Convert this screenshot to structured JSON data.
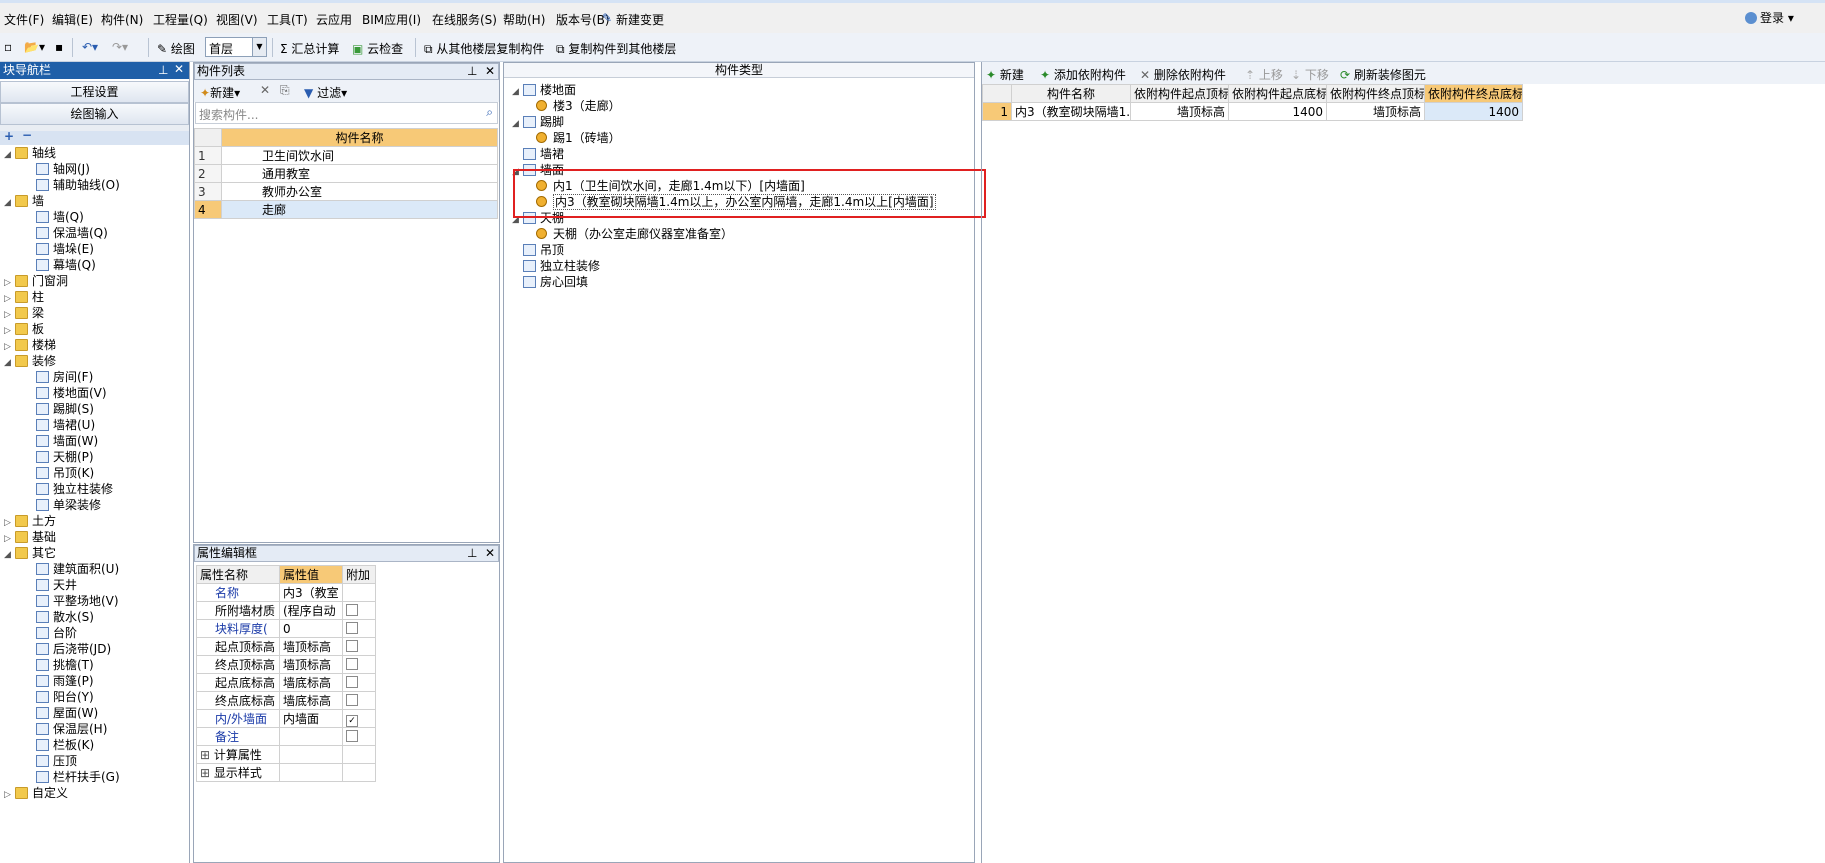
{
  "menu": [
    "文件(F)",
    "编辑(E)",
    "构件(N)",
    "工程量(Q)",
    "视图(V)",
    "工具(T)",
    "云应用",
    "BIM应用(I)",
    "在线服务(S)",
    "帮助(H)",
    "版本号(B)",
    "新建变更"
  ],
  "login": "登录",
  "toolbar": {
    "draw": "绘图",
    "floor": "首层",
    "sum": "汇总计算",
    "cloud_check": "云检查",
    "copy_from": "从其他楼层复制构件",
    "copy_to": "复制构件到其他楼层"
  },
  "nav": {
    "title": "块导航栏",
    "btn_project": "工程设置",
    "btn_draw": "绘图输入",
    "tree": [
      {
        "label": "轴线",
        "level": 0,
        "exp": "◢",
        "folder": true
      },
      {
        "label": "轴网(J)",
        "level": 1
      },
      {
        "label": "辅助轴线(O)",
        "level": 1
      },
      {
        "label": "墙",
        "level": 0,
        "exp": "◢",
        "folder": true
      },
      {
        "label": "墙(Q)",
        "level": 1
      },
      {
        "label": "保温墙(Q)",
        "level": 1
      },
      {
        "label": "墙垛(E)",
        "level": 1
      },
      {
        "label": "幕墙(Q)",
        "level": 1
      },
      {
        "label": "门窗洞",
        "level": 0,
        "exp": "▷",
        "folder": true
      },
      {
        "label": "柱",
        "level": 0,
        "exp": "▷",
        "folder": true
      },
      {
        "label": "梁",
        "level": 0,
        "exp": "▷",
        "folder": true
      },
      {
        "label": "板",
        "level": 0,
        "exp": "▷",
        "folder": true
      },
      {
        "label": "楼梯",
        "level": 0,
        "exp": "▷",
        "folder": true
      },
      {
        "label": "装修",
        "level": 0,
        "exp": "◢",
        "folder": true
      },
      {
        "label": "房间(F)",
        "level": 1
      },
      {
        "label": "楼地面(V)",
        "level": 1
      },
      {
        "label": "踢脚(S)",
        "level": 1
      },
      {
        "label": "墙裙(U)",
        "level": 1
      },
      {
        "label": "墙面(W)",
        "level": 1
      },
      {
        "label": "天棚(P)",
        "level": 1
      },
      {
        "label": "吊顶(K)",
        "level": 1
      },
      {
        "label": "独立柱装修",
        "level": 1
      },
      {
        "label": "单梁装修",
        "level": 1
      },
      {
        "label": "土方",
        "level": 0,
        "exp": "▷",
        "folder": true
      },
      {
        "label": "基础",
        "level": 0,
        "exp": "▷",
        "folder": true
      },
      {
        "label": "其它",
        "level": 0,
        "exp": "◢",
        "folder": true
      },
      {
        "label": "建筑面积(U)",
        "level": 1
      },
      {
        "label": "天井",
        "level": 1
      },
      {
        "label": "平整场地(V)",
        "level": 1
      },
      {
        "label": "散水(S)",
        "level": 1
      },
      {
        "label": "台阶",
        "level": 1
      },
      {
        "label": "后浇带(JD)",
        "level": 1
      },
      {
        "label": "挑檐(T)",
        "level": 1
      },
      {
        "label": "雨篷(P)",
        "level": 1
      },
      {
        "label": "阳台(Y)",
        "level": 1
      },
      {
        "label": "屋面(W)",
        "level": 1
      },
      {
        "label": "保温层(H)",
        "level": 1
      },
      {
        "label": "栏板(K)",
        "level": 1
      },
      {
        "label": "压顶",
        "level": 1
      },
      {
        "label": "栏杆扶手(G)",
        "level": 1
      },
      {
        "label": "自定义",
        "level": 0,
        "exp": "▷",
        "folder": true
      }
    ]
  },
  "component_list": {
    "title": "构件列表",
    "new": "新建",
    "filter": "过滤",
    "search_placeholder": "搜索构件...",
    "col_name": "构件名称",
    "rows": [
      {
        "num": "1",
        "name": "卫生间饮水间"
      },
      {
        "num": "2",
        "name": "通用教室"
      },
      {
        "num": "3",
        "name": "教师办公室"
      },
      {
        "num": "4",
        "name": "走廊"
      }
    ]
  },
  "props": {
    "title": "属性编辑框",
    "col_name": "属性名称",
    "col_value": "属性值",
    "col_extra": "附加",
    "rows": [
      {
        "name": "名称",
        "value": "内3（教室",
        "blue": true,
        "check": false,
        "nocheck": true
      },
      {
        "name": "所附墙材质",
        "value": "(程序自动",
        "blue": false,
        "check": false
      },
      {
        "name": "块料厚度(",
        "value": "0",
        "blue": true,
        "check": false
      },
      {
        "name": "起点顶标高",
        "value": "墙顶标高",
        "blue": false,
        "check": false
      },
      {
        "name": "终点顶标高",
        "value": "墙顶标高",
        "blue": false,
        "check": false
      },
      {
        "name": "起点底标高",
        "value": "墙底标高",
        "blue": false,
        "check": false
      },
      {
        "name": "终点底标高",
        "value": "墙底标高",
        "blue": false,
        "check": false
      },
      {
        "name": "内/外墙面",
        "value": "内墙面",
        "blue": true,
        "check": true
      },
      {
        "name": "备注",
        "value": "",
        "blue": true,
        "check": false
      }
    ],
    "groups": [
      "计算属性",
      "显示样式"
    ]
  },
  "types": {
    "title": "构件类型",
    "items": [
      {
        "label": "楼地面",
        "level": 0,
        "exp": "◢"
      },
      {
        "label": "楼3（走廊）",
        "level": 1
      },
      {
        "label": "踢脚",
        "level": 0,
        "exp": "◢"
      },
      {
        "label": "踢1（砖墙）",
        "level": 1
      },
      {
        "label": "墙裙",
        "level": 0,
        "exp": ""
      },
      {
        "label": "墙面",
        "level": 0,
        "exp": "◢"
      },
      {
        "label": "内1（卫生间饮水间，走廊1.4m以下）[内墙面]",
        "level": 1
      },
      {
        "label": "内3（教室砌块隔墙1.4m以上，办公室内隔墙，走廊1.4m以上[内墙面]",
        "level": 1,
        "selected": true
      },
      {
        "label": "天棚",
        "level": 0,
        "exp": "◢"
      },
      {
        "label": "天棚（办公室走廊仪器室准备室）",
        "level": 1
      },
      {
        "label": "吊顶",
        "level": 0,
        "exp": ""
      },
      {
        "label": "独立柱装修",
        "level": 0,
        "exp": ""
      },
      {
        "label": "房心回填",
        "level": 0,
        "exp": ""
      }
    ]
  },
  "attach": {
    "toolbar": [
      "新建",
      "添加依附构件",
      "删除依附构件",
      "上移",
      "下移",
      "刷新装修图元"
    ],
    "headers": [
      "构件名称",
      "依附构件起点顶标",
      "依附构件起点底标",
      "依附构件终点顶标",
      "依附构件终点底标"
    ],
    "rows": [
      {
        "num": "1",
        "cells": [
          "内3（教室砌块隔墙1.",
          "墙顶标高",
          "1400",
          "墙顶标高",
          "1400"
        ]
      }
    ]
  },
  "colors": {
    "highlight_box": "#e02020",
    "header_orange": "#f7c977",
    "selected_row": "#dbe9f8"
  }
}
